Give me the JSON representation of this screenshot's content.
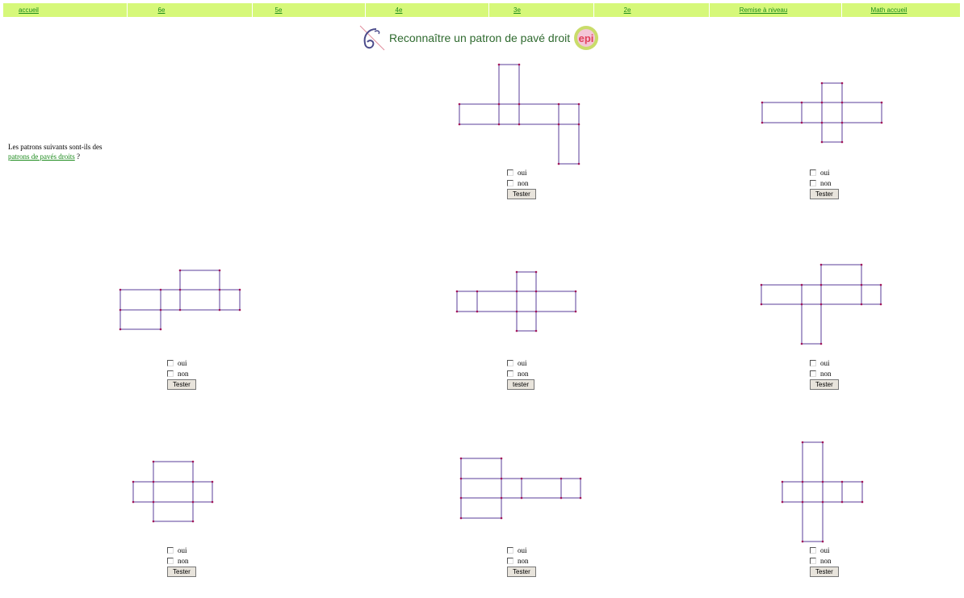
{
  "nav": [
    {
      "label": "accueil"
    },
    {
      "label": "6e"
    },
    {
      "label": "5e"
    },
    {
      "label": "4e"
    },
    {
      "label": "3e"
    },
    {
      "label": "2e"
    },
    {
      "label": "Remise à niveau"
    },
    {
      "label": "Math accueil"
    }
  ],
  "page_title": "Reconnaître un patron de pavé droit",
  "logo_epi_text": "epi",
  "intro": {
    "text": "Les patrons suivants sont-ils des",
    "link": "patrons de pavés droits",
    "suffix": " ?"
  },
  "choice_labels": {
    "oui": "oui",
    "non": "non"
  },
  "exercises": [
    {
      "button": "Tester"
    },
    {
      "button": "Tester"
    },
    {
      "button": "Tester"
    },
    {
      "button": "tester"
    },
    {
      "button": "Tester"
    },
    {
      "button": "Tester"
    },
    {
      "button": "Tester"
    },
    {
      "button": "Tester"
    }
  ],
  "colors": {
    "nav_bg": "#d6f87a",
    "link": "#1a8a1a",
    "title": "#2f6a2f",
    "net_stroke": "#5a3d9a",
    "net_vertex": "#a0155a"
  }
}
